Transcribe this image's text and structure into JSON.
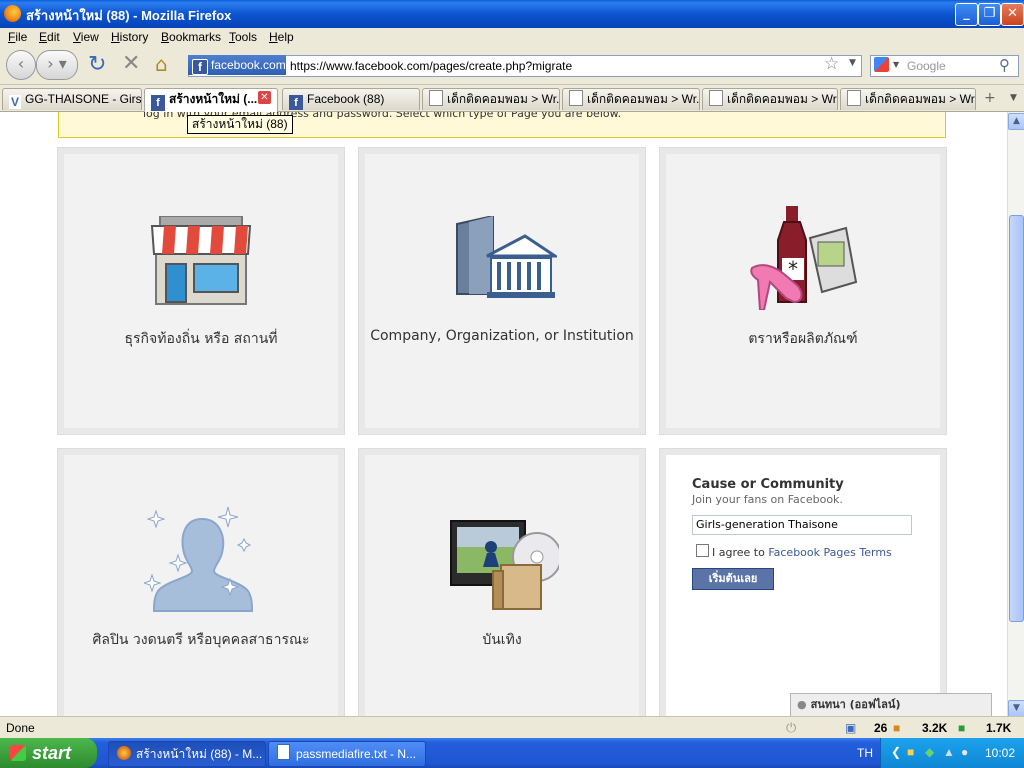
{
  "window": {
    "title": "สร้างหน้าใหม่ (88) - Mozilla Firefox"
  },
  "menu": [
    "File",
    "Edit",
    "View",
    "History",
    "Bookmarks",
    "Tools",
    "Help"
  ],
  "nav": {
    "site_badge": "facebook.com",
    "url": "https://www.facebook.com/pages/create.php?migrate",
    "search_placeholder": "Google"
  },
  "tabs": [
    {
      "label": "GG-THAISONE - Girs..."
    },
    {
      "label": "สร้างหน้าใหม่ (..."
    },
    {
      "label": "Facebook (88)"
    },
    {
      "label": "เด็กติดคอมพอม > Wr..."
    },
    {
      "label": "เด็กติดคอมพอม > Wr..."
    },
    {
      "label": "เด็กติดคอมพอม > Wr..."
    },
    {
      "label": "เด็กติดคอมพอม > Wr..."
    }
  ],
  "tooltip": "สร้างหน้าใหม่ (88)",
  "notice": "log in with your email address and password. Select which type of Page you are below.",
  "cards": [
    {
      "label": "ธุรกิจท้องถิ่น หรือ สถานที่"
    },
    {
      "label": "Company, Organization, or Institution"
    },
    {
      "label": "ตราหรือผลิตภัณฑ์"
    },
    {
      "label": "ศิลปิน วงดนตรี หรือบุคคลสาธารณะ"
    },
    {
      "label": "บันเทิง"
    }
  ],
  "form": {
    "title": "Cause or Community",
    "subtitle": "Join your fans on Facebook.",
    "name_value": "Girls-generation Thaisone",
    "agree_prefix": "I agree to ",
    "agree_link": "Facebook Pages Terms",
    "submit": "เริ่มต้นเลย"
  },
  "chat": "สนทนา (ออฟไลน์)",
  "status": {
    "text": "Done",
    "count1": "26",
    "count2": "3.2K",
    "count3": "1.7K"
  },
  "taskbar": {
    "start": "start",
    "tasks": [
      "สร้างหน้าใหม่ (88) - M...",
      "passmediafire.txt - N..."
    ],
    "lang": "TH",
    "clock": "10:02"
  }
}
